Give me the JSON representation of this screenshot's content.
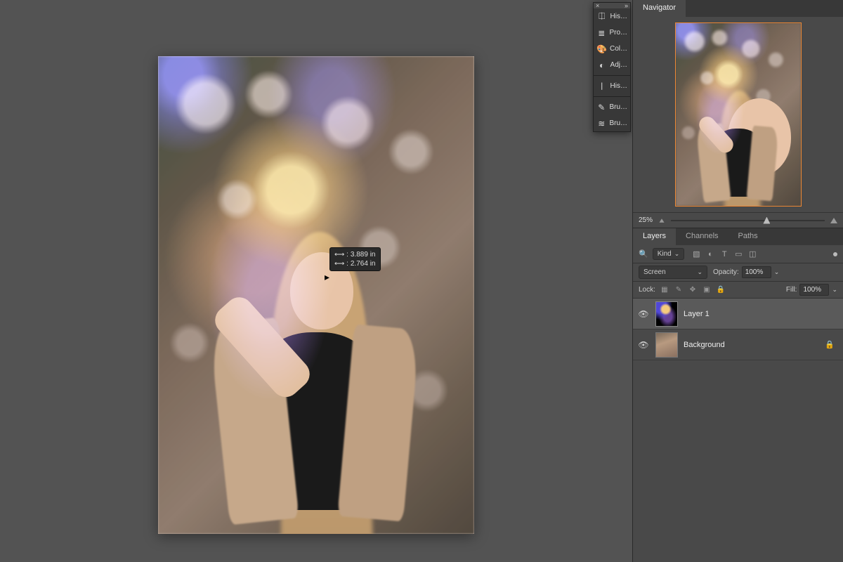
{
  "tooltip": {
    "w_label": "⟷ :",
    "w": "3.889 in",
    "h_label": "⟷ :",
    "h": "2.764 in"
  },
  "props": {
    "items": [
      {
        "icon": "⎅",
        "label": "His…"
      },
      {
        "icon": "≣",
        "label": "Pro…"
      },
      {
        "icon": "🎨",
        "label": "Col…"
      },
      {
        "icon": "◐",
        "label": "Adj…"
      },
      {
        "icon": "〡",
        "label": "His…"
      },
      {
        "icon": "✎",
        "label": "Bru…"
      },
      {
        "icon": "≋",
        "label": "Bru…"
      }
    ]
  },
  "navigator": {
    "tab": "Navigator",
    "zoom": "25%"
  },
  "layers": {
    "tabs": [
      "Layers",
      "Channels",
      "Paths"
    ],
    "kind_label": "Kind",
    "blend_mode": "Screen",
    "opacity_label": "Opacity:",
    "opacity": "100%",
    "lock_label": "Lock:",
    "fill_label": "Fill:",
    "fill": "100%",
    "items": [
      {
        "name": "Layer 1",
        "selected": true,
        "visible": true,
        "thumb": "flare"
      },
      {
        "name": "Background",
        "selected": false,
        "visible": true,
        "thumb": "bg",
        "locked": true
      }
    ]
  },
  "kind_search_placeholder": "Kind"
}
